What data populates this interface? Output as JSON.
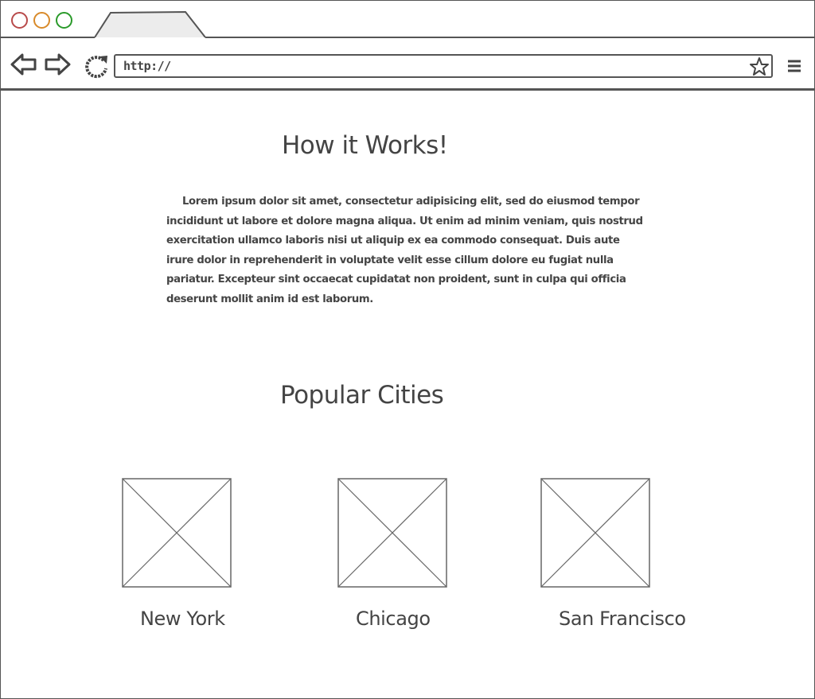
{
  "browser": {
    "url": "http://",
    "icons": [
      "back-arrow-icon",
      "forward-arrow-icon",
      "reload-icon",
      "star-icon",
      "menu-icon"
    ]
  },
  "how_it_works": {
    "title": "How it Works!",
    "body": "Lorem ipsum dolor sit amet, consectetur adipisicing elit, sed do eiusmod tempor incididunt ut labore et dolore magna aliqua. Ut enim ad minim veniam, quis nostrud exercitation ullamco laboris nisi ut aliquip ex ea commodo consequat. Duis aute irure dolor in reprehenderit in voluptate velit esse cillum dolore eu fugiat nulla pariatur. Excepteur sint occaecat cupidatat non proident, sunt in culpa qui officia deserunt mollit anim id est laborum."
  },
  "popular_cities": {
    "title": "Popular Cities",
    "cities": [
      {
        "name": "New York"
      },
      {
        "name": "Chicago"
      },
      {
        "name": "San Francisco"
      }
    ]
  }
}
